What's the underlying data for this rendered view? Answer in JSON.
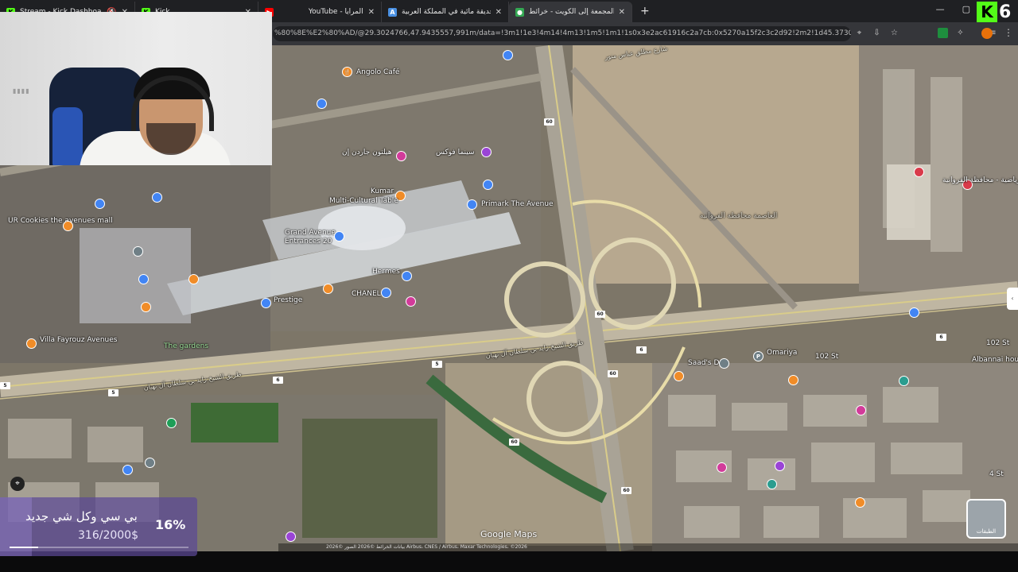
{
  "browser": {
    "tabs": [
      {
        "title": "Stream - Kick Dashboard",
        "icon": "kick-icon",
        "color": "#53fc18",
        "muted": true
      },
      {
        "title": "Kick",
        "icon": "kick-icon",
        "color": "#53fc18"
      },
      {
        "title": "YouTube - المرايا",
        "icon": "youtube-icon",
        "color": "#ff0000"
      },
      {
        "title": "أكبر حديقة مائية في المملكة العربية",
        "icon": "site-icon",
        "color": "#4a90e2"
      },
      {
        "title": "المجمعة إلى الكويت - خرائط Google",
        "icon": "maps-icon",
        "color": "#34a853",
        "active": true
      }
    ],
    "new_tab": "+",
    "url": "%80%8E%E2%80%AD/@29.3024766,47.9435557,991m/data=!3m1!1e3!4m14!4m13!1m5!1m1!1s0x3e2ac61916c2a7cb:0x5270a15f2c3c2d92!2m2!1d45.3730695!2d25.8758866!1..."
  },
  "map": {
    "labels": {
      "angolo": "Angolo Café",
      "hilton": "هيلتون جاردن إن",
      "kumar": "Kumar",
      "multicultural": "Multi-Cultural Table",
      "grand_avenue": "Grand Avenue",
      "entrances": "Entrances 20",
      "cinema": "سينما فوكس",
      "primark": "Primark The Avenue",
      "cookies": "UR Cookies the avenues mall",
      "hermes": "Hermes",
      "chanel": "CHANEL",
      "prestige": "Prestige",
      "villa_fayrouz": "Villa Fayrouz Avenues",
      "gardens": "The gardens",
      "saads_den": "Saad's Den",
      "omariya": "Omariya",
      "st102": "102 St",
      "st102_right": "102 St",
      "albannai": "Albannai house",
      "st4": "4 St",
      "road_main": "طريق الشيخ زايد بن سلطان آل نهيان",
      "road_main2": "طريق الشيخ زايد بن سلطان آل نهيان",
      "road_top": "شارع مطلق عباس منور",
      "asimah": "العاصمة محافظة الفروانية",
      "sports": "الرياضية - محافظة الفروانية"
    },
    "shields": [
      "60",
      "5",
      "5",
      "5",
      "6",
      "60",
      "60",
      "60",
      "60",
      "6",
      "6"
    ],
    "watermark": "Google Maps",
    "attribution": "بيانات الخرائط ©2026 الصور ©2026 Airbus، CNES / Airbus، Maxar Technologies، ©2026",
    "layers_label": "الطبقات"
  },
  "kick": {
    "logo_letter": "K",
    "number": "6"
  },
  "goal": {
    "title": "بي سي وكل شي جديد",
    "percent": 0.16,
    "percent_label": "16%",
    "amount": "316/2000$"
  },
  "webcam": {
    "tag": "▮▮▮▮"
  },
  "colors": {
    "kick_green": "#53fc18",
    "goal_purple": "#5c4896"
  }
}
